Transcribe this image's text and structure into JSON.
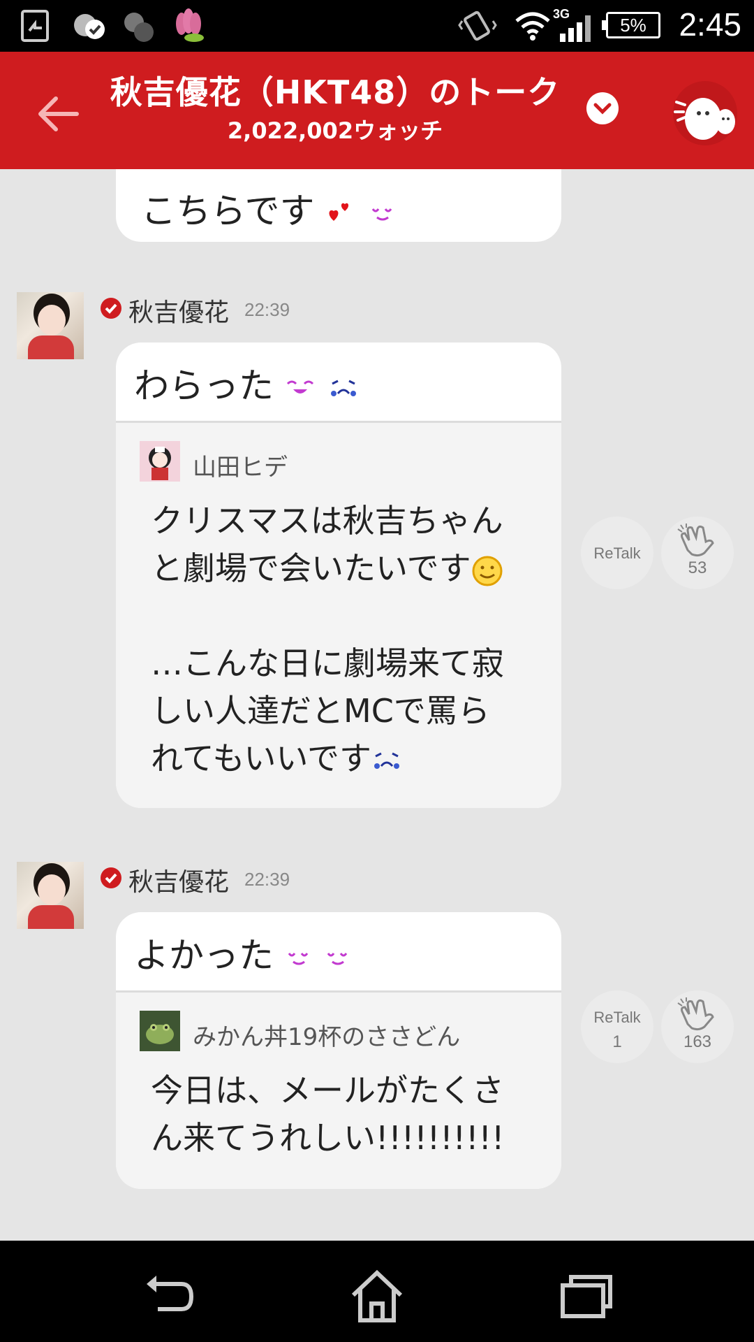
{
  "status_bar": {
    "time": "2:45",
    "battery": "5%",
    "network": "3G",
    "icons": [
      "screen-share-icon",
      "cloud-check-icon",
      "circles-app-icon",
      "lotus-app-icon",
      "vibrate-icon",
      "wifi-icon",
      "signal-icon",
      "battery-icon"
    ]
  },
  "header": {
    "title": "秋吉優花（HKT48）のトーク",
    "watch_count": "2,022,002ウォッチ",
    "accent_color": "#cf1c1f"
  },
  "messages": [
    {
      "partial": true,
      "text": "こちらです"
    },
    {
      "sender": "秋吉優花",
      "time": "22:39",
      "text": "わらった",
      "quote": {
        "author": "山田ヒデ",
        "lines": [
          "クリスマスは秋吉ちゃん",
          "と劇場で会いたいです",
          "",
          "…こんな日に劇場来て寂",
          "しい人達だとMCで罵ら",
          "れてもいいです"
        ]
      },
      "retalk_label": "ReTalk",
      "retalk_count": "",
      "clap_count": "53"
    },
    {
      "sender": "秋吉優花",
      "time": "22:39",
      "text": "よかった",
      "quote": {
        "author": "みかん丼19杯のささどん",
        "lines": [
          "今日は、メールがたくさ",
          "ん来てうれしい!!!!!!!!!!"
        ]
      },
      "retalk_label": "ReTalk",
      "retalk_count": "1",
      "clap_count": "163"
    }
  ],
  "nav": {
    "buttons": [
      "back-nav-icon",
      "home-nav-icon",
      "recent-apps-icon"
    ]
  }
}
